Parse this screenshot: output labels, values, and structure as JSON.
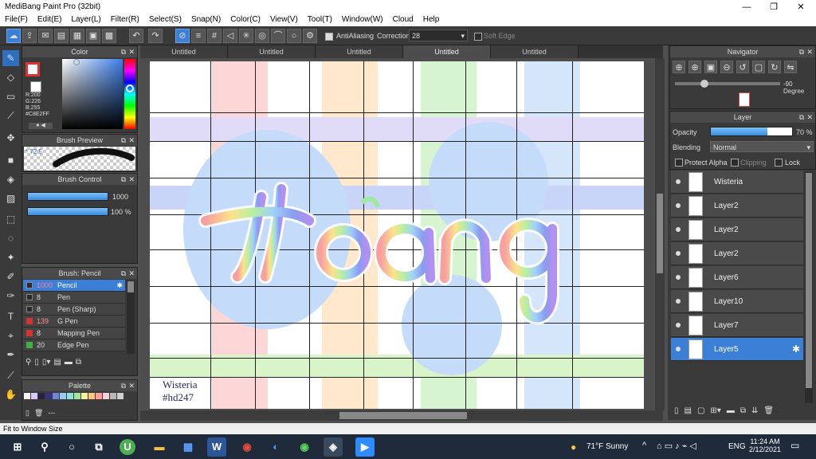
{
  "window": {
    "title": "MediBang Paint Pro (32bit)",
    "minimize": "—",
    "maximize": "❐",
    "close": "✕"
  },
  "menu": [
    "File(F)",
    "Edit(E)",
    "Layer(L)",
    "Filter(R)",
    "Select(S)",
    "Snap(N)",
    "Color(C)",
    "View(V)",
    "Tool(T)",
    "Window(W)",
    "Cloud",
    "Help"
  ],
  "toolbar": {
    "antialiasing": "AntiAliasing",
    "correction_label": "Correction",
    "correction_value": "28",
    "soft_edge": "Soft Edge"
  },
  "color_panel": {
    "title": "Color",
    "r": "R:200",
    "g": "G:226",
    "b": "B:255",
    "hex": "#C8E2FF",
    "primary": "#e03030",
    "secondary": "#ffffff"
  },
  "brush_preview": {
    "title": "Brush Preview",
    "size": "* 72.5"
  },
  "brush_control": {
    "title": "Brush Control",
    "size_value": "1000",
    "opacity_value": "100 %"
  },
  "brush_list": {
    "title": "Brush: Pencil",
    "items": [
      {
        "size": "1000",
        "name": "Pencil",
        "color": "#2a2a2a",
        "selected": true
      },
      {
        "size": "8",
        "name": "Pen",
        "color": "#2a2a2a"
      },
      {
        "size": "8",
        "name": "Pen (Sharp)",
        "color": "#2a2a2a"
      },
      {
        "size": "139",
        "name": "G Pen",
        "color": "#d93030"
      },
      {
        "size": "8",
        "name": "Mapping Pen",
        "color": "#d93030"
      },
      {
        "size": "20",
        "name": "Edge Pen",
        "color": "#40b040"
      }
    ]
  },
  "palette": {
    "title": "Palette",
    "colors": [
      "#f6f6f6",
      "#d7c8ff",
      "#2a2040",
      "#3a3080",
      "#6b88d8",
      "#9cc8f4",
      "#90e0e0",
      "#a0e8a0",
      "#fff0a0",
      "#ffc878",
      "#ff9c9c",
      "#f8d0d8",
      "#b8b8b8",
      "#d0d0d0"
    ],
    "dash": "---"
  },
  "tabs": [
    {
      "label": "Untitled"
    },
    {
      "label": "Untitled"
    },
    {
      "label": "Untitled"
    },
    {
      "label": "Untitled",
      "active": true
    },
    {
      "label": "Untitled"
    }
  ],
  "canvas": {
    "lettering": "Hoàng",
    "signature_line1": "Wisteria",
    "signature_line2": "#hd247"
  },
  "navigator": {
    "title": "Navigator",
    "rotation": "-90 Degree"
  },
  "layer_panel": {
    "title": "Layer",
    "opacity_label": "Opacity",
    "opacity_value": "70 %",
    "opacity_level": 0.7,
    "blending_label": "Blending",
    "blending_value": "Normal",
    "protect_alpha": "Protect Alpha",
    "clipping": "Clipping",
    "lock": "Lock",
    "layers": [
      {
        "name": "Wisteria"
      },
      {
        "name": "Layer2"
      },
      {
        "name": "Layer2"
      },
      {
        "name": "Layer2"
      },
      {
        "name": "Layer6"
      },
      {
        "name": "Layer10"
      },
      {
        "name": "Layer7"
      },
      {
        "name": "Layer5",
        "selected": true
      }
    ]
  },
  "status": {
    "text": "Fit to Window Size"
  },
  "taskbar": {
    "weather": "71°F  Sunny",
    "lang": "ENG",
    "time": "11:24 AM",
    "date": "2/12/2021"
  }
}
